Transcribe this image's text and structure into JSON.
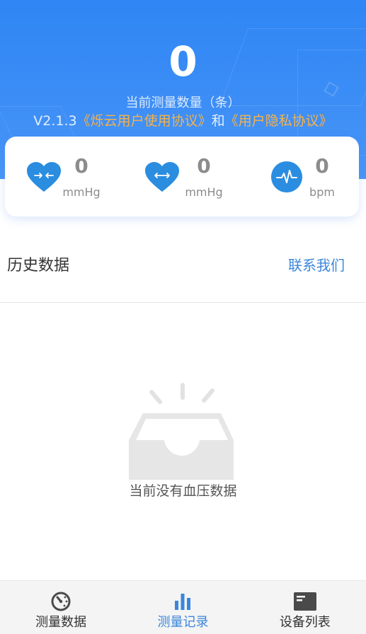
{
  "header": {
    "count": "0",
    "count_label": "当前测量数量（条）",
    "version": "V2.1.3",
    "agreement_user": "《烁云用户使用协议》",
    "agreement_and": "和",
    "agreement_privacy": "《用户隐私协议》"
  },
  "metrics": [
    {
      "icon": "heart-compress-icon",
      "value": "0",
      "unit": "mmHg"
    },
    {
      "icon": "heart-expand-icon",
      "value": "0",
      "unit": "mmHg"
    },
    {
      "icon": "pulse-icon",
      "value": "0",
      "unit": "bpm"
    }
  ],
  "history": {
    "title": "历史数据",
    "contact_label": "联系我们",
    "empty_text": "当前没有血压数据"
  },
  "tabs": [
    {
      "label": "测量数据",
      "icon": "gauge-icon",
      "active": false
    },
    {
      "label": "测量记录",
      "icon": "bar-chart-icon",
      "active": true
    },
    {
      "label": "设备列表",
      "icon": "device-icon",
      "active": false
    }
  ],
  "colors": {
    "primary": "#2f86f4",
    "accent_link": "#f6b24a",
    "active_tab": "#3a86dd",
    "icon_blue": "#2a8de0"
  }
}
